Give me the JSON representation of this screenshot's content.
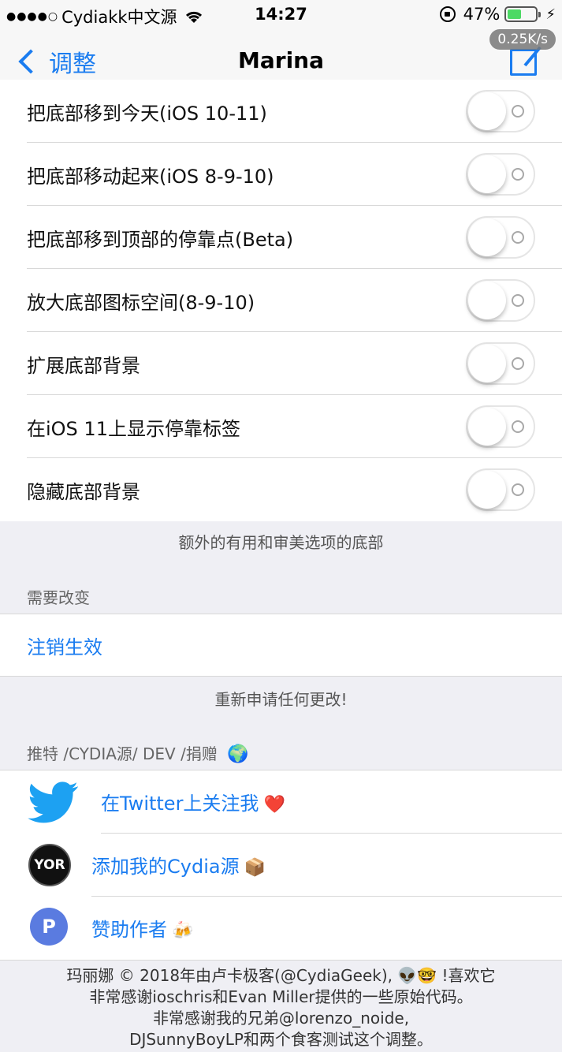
{
  "status": {
    "carrier": "Cydiakk中文源",
    "time": "14:27",
    "battery": "47%",
    "battery_level": 0.47
  },
  "nav": {
    "back_label": "调整",
    "title": "Marina",
    "speed_badge": "0.25K/s"
  },
  "toggles": [
    {
      "label": "把底部移到今天(iOS 10-11)",
      "on": false
    },
    {
      "label": "把底部移动起来(iOS 8-9-10)",
      "on": false
    },
    {
      "label": "把底部移到顶部的停靠点(Beta)",
      "on": false
    },
    {
      "label": "放大底部图标空间(8-9-10)",
      "on": false
    },
    {
      "label": "扩展底部背景",
      "on": false
    },
    {
      "label": "在iOS 11上显示停靠标签",
      "on": false
    },
    {
      "label": "隐藏底部背景",
      "on": false
    }
  ],
  "toggles_footer": "额外的有用和审美选项的底部",
  "respring": {
    "header": "需要改变",
    "button": "注销生效",
    "footer": "重新申请任何更改!"
  },
  "social": {
    "header": "推特 /CYDIA源/ DEV /捐赠",
    "header_emoji": "🌍",
    "items": [
      {
        "label": "在Twitter上关注我",
        "emoji": "❤️",
        "icon": "twitter-bird"
      },
      {
        "label": "添加我的Cydia源",
        "emoji": "📦",
        "icon": "yor-repo-logo",
        "icon_text": "YOR"
      },
      {
        "label": "赞助作者",
        "emoji": "🍻",
        "icon": "paypal-logo",
        "icon_text": "P"
      }
    ]
  },
  "credits": [
    "玛丽娜 © 2018年由卢卡极客(@CydiaGeek), 👽🤓 !喜欢它",
    "非常感谢ioschris和Evan Miller提供的一些原始代码。",
    "非常感谢我的兄弟@lorenzo_noide,",
    "DJSunnyBoyLP和两个食客测试这个调整。"
  ],
  "colors": {
    "accent": "#1a7cf0",
    "background": "#efeff4",
    "battery": "#4cd964"
  }
}
